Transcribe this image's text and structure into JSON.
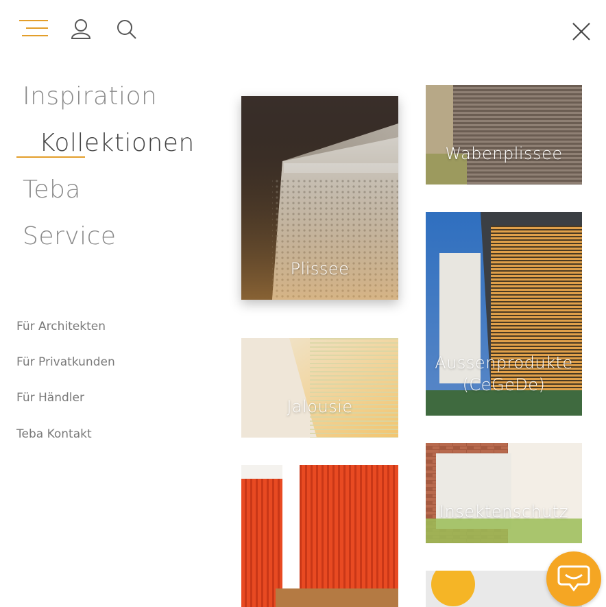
{
  "header": {
    "icons": [
      "menu-icon",
      "user-icon",
      "search-icon",
      "close-icon"
    ],
    "accent_color": "#e39e2a"
  },
  "main_nav": {
    "items": [
      "Inspiration",
      "Kollektionen",
      "Teba",
      "Service"
    ],
    "active": "Kollektionen"
  },
  "sub_nav": {
    "items": [
      "Für Architekten",
      "Für Privatkunden",
      "Für Händler",
      "Teba Kontakt"
    ]
  },
  "tiles": {
    "plissee": "Plissee",
    "wabenplissee": "Wabenplissee",
    "jalousie": "Jalousie",
    "aussenprodukte": "Aussenprodukte\n(CeGeDe)",
    "insektenschutz": "Insektenschutz"
  },
  "chat": {
    "icon": "chat-icon",
    "color": "#f5a623"
  }
}
